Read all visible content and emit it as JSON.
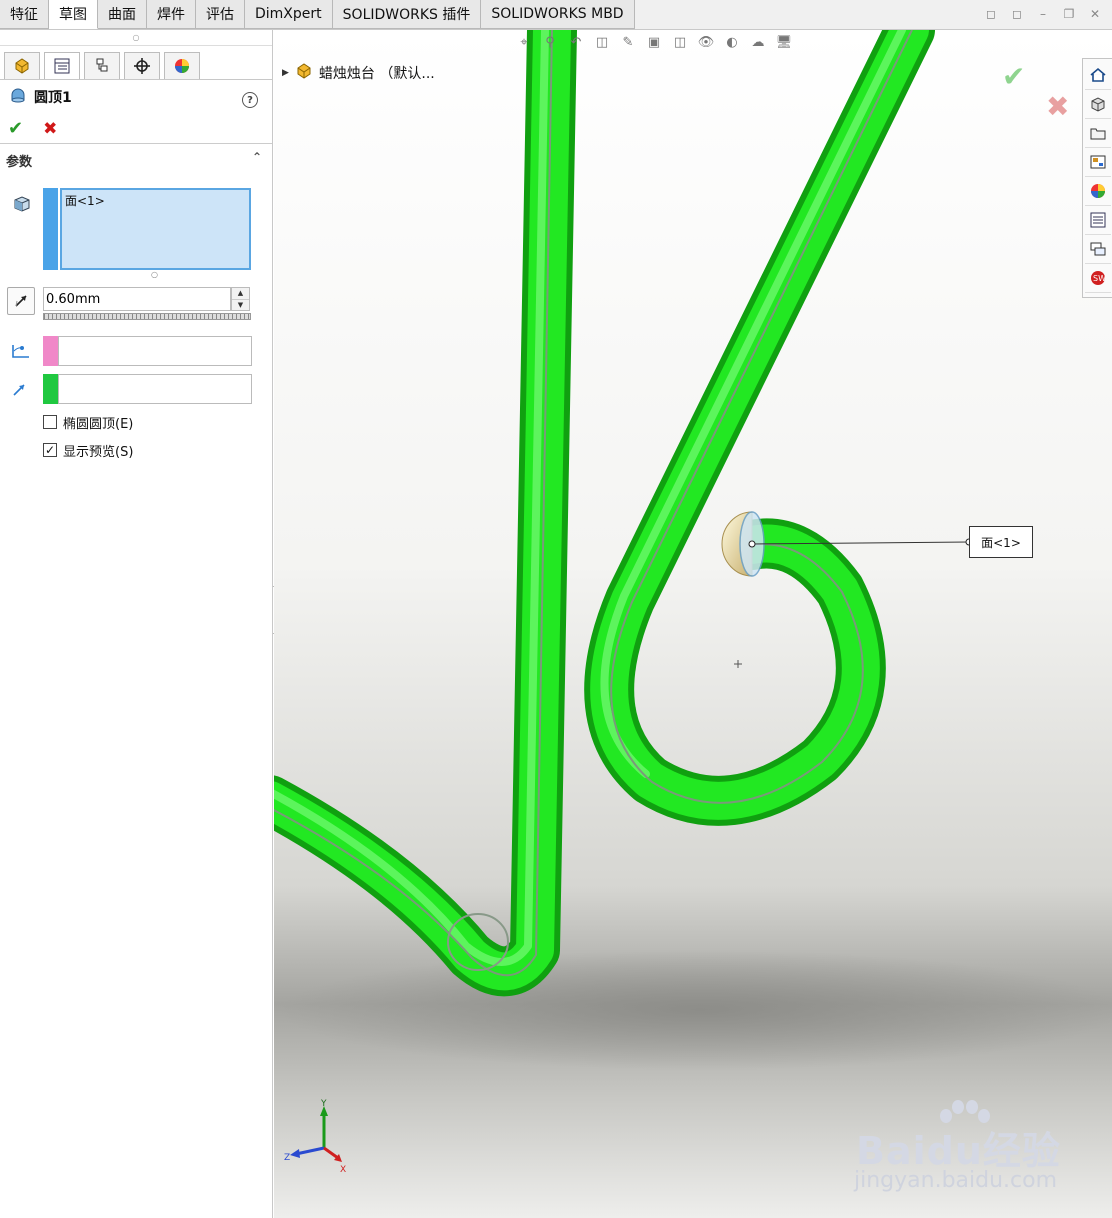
{
  "tabs": [
    "特征",
    "草图",
    "曲面",
    "焊件",
    "评估",
    "DimXpert",
    "SOLIDWORKS 插件",
    "SOLIDWORKS MBD"
  ],
  "active_tab": "草图",
  "feature": {
    "title": "圆顶1",
    "help": "?"
  },
  "params": {
    "section_title": "参数",
    "face_selection": "面<1>",
    "distance": "0.60mm",
    "elliptical_dome": "椭圆圆顶(E)",
    "show_preview": "显示预览(S)",
    "elliptical_dome_checked": false,
    "show_preview_checked": true,
    "constraint_color": "#f088c8",
    "direction_color": "#20c840",
    "face_color": "#4aa3e8"
  },
  "viewport": {
    "tree_item": "蜡烛烛台 （默认...",
    "callout_label": "面<1>",
    "model_color": "#1ee01e"
  },
  "watermark": {
    "logo": "Baidu经验",
    "url": "jingyan.baidu.com"
  },
  "taskpane_icons": [
    "home-icon",
    "resources-icon",
    "folder-icon",
    "view-palette-icon",
    "appearance-icon",
    "custom-properties-icon",
    "forum-icon",
    "solidworks-icon"
  ]
}
